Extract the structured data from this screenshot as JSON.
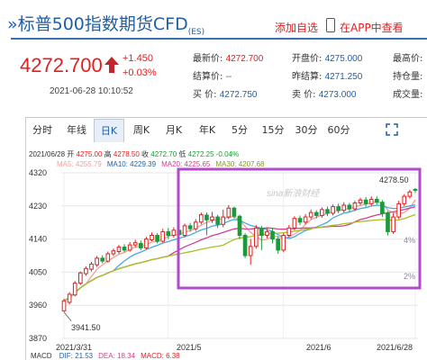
{
  "header": {
    "title": "»标普500指数期货CFD",
    "title_sub": "(ES)",
    "watchlist_label": "添加自选",
    "app_label": "在APP中查看"
  },
  "quote": {
    "price": "4272.700",
    "change": "+1.450",
    "change_pct": "+0.03%",
    "datetime": "2021-06-28 10:10:52",
    "fields": [
      {
        "label": "最新价:",
        "value": "4272.700",
        "red": true
      },
      {
        "label": "开盘价:",
        "value": "4275.000",
        "red": false
      },
      {
        "label": "最高价:",
        "value": "",
        "red": false
      },
      {
        "label": "结算价:",
        "value": "--",
        "red": false
      },
      {
        "label": "昨结算:",
        "value": "4271.250",
        "red": false
      },
      {
        "label": "持仓量:",
        "value": "",
        "red": false
      },
      {
        "label": "买  价:",
        "value": "4272.750",
        "red": false
      },
      {
        "label": "卖  价:",
        "value": "4273.000",
        "red": false
      },
      {
        "label": "成交量:",
        "value": "",
        "red": false
      }
    ]
  },
  "tabs": [
    "分时",
    "年线",
    "日K",
    "周K",
    "月K",
    "年K",
    "5分",
    "15分",
    "30分",
    "60分"
  ],
  "active_tab": "日K",
  "info_line": {
    "date": "2021/06/28",
    "open_label": "开",
    "open": "4275.00",
    "high_label": "高",
    "high": "4278.50",
    "close_label": "收",
    "close": "4272.70",
    "low_label": "低",
    "low": "4272.25",
    "pct": "-0.04%"
  },
  "ma_line": [
    {
      "label": "MA5:",
      "value": "4255.79",
      "color": "#f0a0a0"
    },
    {
      "label": "MA10:",
      "value": "4229.39",
      "color": "#1f5fa8"
    },
    {
      "label": "MA20:",
      "value": "4225.65",
      "color": "#d04090"
    },
    {
      "label": "MA30:",
      "value": "4207.68",
      "color": "#8a9a20"
    }
  ],
  "bottom_line": [
    {
      "label": "MACD",
      "value": "",
      "color": "#333"
    },
    {
      "label": "DIF:",
      "value": "21.53",
      "color": "#1f5fa8"
    },
    {
      "label": "DEA:",
      "value": "18.34",
      "color": "#d04090"
    },
    {
      "label": "MACD:",
      "value": "6.38",
      "color": "#e02020"
    }
  ],
  "chart_data": {
    "type": "candlestick",
    "y_ticks": [
      "4320",
      "4230",
      "4140",
      "4050",
      "3960",
      "3870"
    ],
    "x_ticks": [
      "2021/3/31",
      "2021/5",
      "2021/6",
      "2021/6/28"
    ],
    "right_pct_ticks": [
      "4%",
      "2%"
    ],
    "ylim": [
      3870,
      4320
    ],
    "max_label": "4278.50",
    "min_label": "3941.50",
    "watermark": "sina新浪财经",
    "highlight_box_color": "#b24bc9",
    "up_color": "#e02020",
    "down_color": "#1a9a3a",
    "candles": [
      {
        "o": 3945,
        "c": 3972,
        "h": 3978,
        "l": 3941.5
      },
      {
        "o": 3968,
        "c": 3990,
        "h": 3996,
        "l": 3962
      },
      {
        "o": 3988,
        "c": 4020,
        "h": 4026,
        "l": 3984
      },
      {
        "o": 4020,
        "c": 4048,
        "h": 4052,
        "l": 4015
      },
      {
        "o": 4046,
        "c": 4060,
        "h": 4066,
        "l": 4040
      },
      {
        "o": 4058,
        "c": 4072,
        "h": 4078,
        "l": 4052
      },
      {
        "o": 4070,
        "c": 4088,
        "h": 4094,
        "l": 4064
      },
      {
        "o": 4088,
        "c": 4080,
        "h": 4096,
        "l": 4074
      },
      {
        "o": 4080,
        "c": 4100,
        "h": 4106,
        "l": 4076
      },
      {
        "o": 4100,
        "c": 4108,
        "h": 4114,
        "l": 4094
      },
      {
        "o": 4106,
        "c": 4118,
        "h": 4124,
        "l": 4100
      },
      {
        "o": 4118,
        "c": 4110,
        "h": 4126,
        "l": 4104
      },
      {
        "o": 4110,
        "c": 4124,
        "h": 4132,
        "l": 4106
      },
      {
        "o": 4124,
        "c": 4130,
        "h": 4138,
        "l": 4118
      },
      {
        "o": 4128,
        "c": 4116,
        "h": 4136,
        "l": 4110
      },
      {
        "o": 4116,
        "c": 4140,
        "h": 4146,
        "l": 4112
      },
      {
        "o": 4138,
        "c": 4150,
        "h": 4158,
        "l": 4134
      },
      {
        "o": 4150,
        "c": 4134,
        "h": 4156,
        "l": 4128
      },
      {
        "o": 4134,
        "c": 4160,
        "h": 4168,
        "l": 4130
      },
      {
        "o": 4160,
        "c": 4150,
        "h": 4170,
        "l": 4140
      },
      {
        "o": 4150,
        "c": 4164,
        "h": 4172,
        "l": 4144
      },
      {
        "o": 4164,
        "c": 4152,
        "h": 4174,
        "l": 4146
      },
      {
        "o": 4150,
        "c": 4176,
        "h": 4182,
        "l": 4144
      },
      {
        "o": 4176,
        "c": 4168,
        "h": 4184,
        "l": 4160
      },
      {
        "o": 4168,
        "c": 4186,
        "h": 4194,
        "l": 4162
      },
      {
        "o": 4186,
        "c": 4206,
        "h": 4212,
        "l": 4180
      },
      {
        "o": 4205,
        "c": 4192,
        "h": 4212,
        "l": 4150
      },
      {
        "o": 4192,
        "c": 4200,
        "h": 4214,
        "l": 4184
      },
      {
        "o": 4200,
        "c": 4180,
        "h": 4206,
        "l": 4170
      },
      {
        "o": 4180,
        "c": 4200,
        "h": 4220,
        "l": 4172
      },
      {
        "o": 4200,
        "c": 4224,
        "h": 4232,
        "l": 4194
      },
      {
        "o": 4224,
        "c": 4202,
        "h": 4228,
        "l": 4196
      },
      {
        "o": 4202,
        "c": 4150,
        "h": 4206,
        "l": 4140
      },
      {
        "o": 4150,
        "c": 4095,
        "h": 4156,
        "l": 4088
      },
      {
        "o": 4095,
        "c": 4120,
        "h": 4140,
        "l": 4070
      },
      {
        "o": 4120,
        "c": 4170,
        "h": 4178,
        "l": 4114
      },
      {
        "o": 4168,
        "c": 4150,
        "h": 4176,
        "l": 4110
      },
      {
        "o": 4150,
        "c": 4160,
        "h": 4168,
        "l": 4142
      },
      {
        "o": 4160,
        "c": 4140,
        "h": 4170,
        "l": 4128
      },
      {
        "o": 4140,
        "c": 4110,
        "h": 4148,
        "l": 4100
      },
      {
        "o": 4110,
        "c": 4150,
        "h": 4156,
        "l": 4104
      },
      {
        "o": 4150,
        "c": 4170,
        "h": 4178,
        "l": 4144
      },
      {
        "o": 4170,
        "c": 4196,
        "h": 4202,
        "l": 4164
      },
      {
        "o": 4196,
        "c": 4186,
        "h": 4204,
        "l": 4178
      },
      {
        "o": 4186,
        "c": 4200,
        "h": 4208,
        "l": 4180
      },
      {
        "o": 4200,
        "c": 4212,
        "h": 4220,
        "l": 4194
      },
      {
        "o": 4212,
        "c": 4204,
        "h": 4218,
        "l": 4196
      },
      {
        "o": 4204,
        "c": 4220,
        "h": 4226,
        "l": 4198
      },
      {
        "o": 4220,
        "c": 4210,
        "h": 4228,
        "l": 4202
      },
      {
        "o": 4210,
        "c": 4228,
        "h": 4234,
        "l": 4204
      },
      {
        "o": 4228,
        "c": 4218,
        "h": 4236,
        "l": 4210
      },
      {
        "o": 4218,
        "c": 4232,
        "h": 4240,
        "l": 4212
      },
      {
        "o": 4232,
        "c": 4222,
        "h": 4238,
        "l": 4214
      },
      {
        "o": 4222,
        "c": 4238,
        "h": 4244,
        "l": 4216
      },
      {
        "o": 4238,
        "c": 4246,
        "h": 4252,
        "l": 4232
      },
      {
        "o": 4246,
        "c": 4236,
        "h": 4254,
        "l": 4228
      },
      {
        "o": 4236,
        "c": 4248,
        "h": 4256,
        "l": 4230
      },
      {
        "o": 4248,
        "c": 4240,
        "h": 4256,
        "l": 4234
      },
      {
        "o": 4240,
        "c": 4210,
        "h": 4246,
        "l": 4200
      },
      {
        "o": 4210,
        "c": 4160,
        "h": 4216,
        "l": 4150
      },
      {
        "o": 4160,
        "c": 4200,
        "h": 4210,
        "l": 4154
      },
      {
        "o": 4200,
        "c": 4236,
        "h": 4244,
        "l": 4194
      },
      {
        "o": 4236,
        "c": 4256,
        "h": 4262,
        "l": 4230
      },
      {
        "o": 4256,
        "c": 4268,
        "h": 4274,
        "l": 4250
      },
      {
        "o": 4275,
        "c": 4272.7,
        "h": 4278.5,
        "l": 4265
      }
    ]
  }
}
